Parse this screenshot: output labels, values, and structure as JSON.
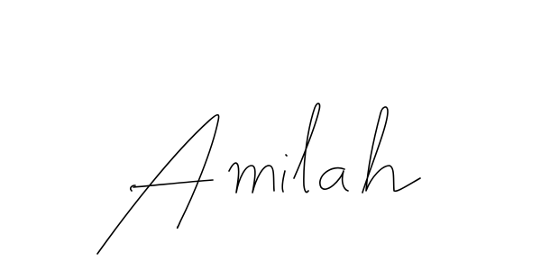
{
  "signature": {
    "text": "Amilah",
    "ink_color": "#000000",
    "background_color": "#ffffff"
  }
}
